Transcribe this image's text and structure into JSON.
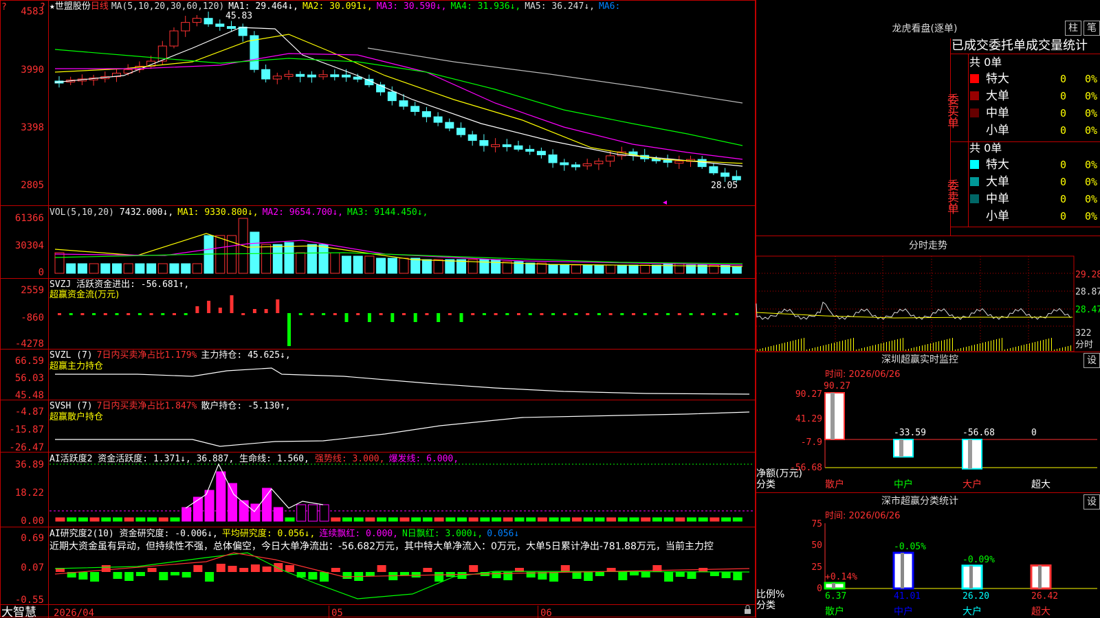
{
  "colors": {
    "up": "#ff3232",
    "down": "#54ffff",
    "ma1": "#ffffff",
    "ma2": "#ffff00",
    "ma3": "#ff00ff",
    "ma4": "#00ff00",
    "ma5": "#bbbbbb",
    "ma6": "#0080ff",
    "frame": "#c00000",
    "axis": "#ff3232"
  },
  "header": {
    "marker": "?",
    "star": "★",
    "stock": "世盟股份",
    "period": "日线",
    "ma_params": "MA(5,10,20,30,60,120)",
    "ma1": "MA1: 29.464↓,",
    "ma2": "MA2: 30.091↓,",
    "ma3": "MA3: 30.590↓,",
    "ma4": "MA4: 31.936↓,",
    "ma5": "MA5: 36.247↓,",
    "ma6": "MA6:"
  },
  "price": {
    "yaxis": [
      "4583",
      "3990",
      "3398",
      "2805"
    ],
    "high_label": "45.83",
    "low_label": "28.05"
  },
  "vol": {
    "legend": "VOL(5,10,20)",
    "value": "7432.000↓,",
    "ma1": "MA1: 9330.800↓,",
    "ma2": "MA2: 9654.700↓,",
    "ma3": "MA3: 9144.450↓,",
    "yaxis": [
      "61366",
      "30304",
      "0"
    ]
  },
  "svzj": {
    "legend": "SVZJ  活跃资金进出: -56.681↑,",
    "sub": "超赢资金流(万元)",
    "yaxis": [
      "2559",
      "-860",
      "-4278"
    ]
  },
  "svzl": {
    "legend": "SVZL (7)",
    "ratio": "7日内买卖净占比1.179%",
    "hold": "主力持仓: 45.625↓,",
    "sub": "超赢主力持仓",
    "yaxis": [
      "66.59",
      "56.03",
      "45.48"
    ]
  },
  "svsh": {
    "legend": "SVSH (7)",
    "ratio": "7日内买卖净占比1.847%",
    "hold": "散户持仓: -5.130↑,",
    "sub": "超赢散户持仓",
    "yaxis": [
      "-4.87",
      "-15.87",
      "-26.47"
    ]
  },
  "ai1": {
    "legend": "AI活跃度2 资金活跃度: 1.371↓, 36.887, 生命线: 1.560,",
    "strong": "强势线: 3.000,",
    "burst": "爆发线: 6.000,",
    "yaxis": [
      "36.89",
      "18.22",
      "0.00"
    ]
  },
  "ai2": {
    "legend": "AI研究度2(10) 资金研究度: -0.006↓,",
    "avg": "平均研究度: 0.056↓,",
    "red": "连续飘红: 0.000,",
    "nred": "N日飘红: 3.000↓,",
    "last": "0.056↓",
    "comment": "近期大资金虽有异动，但持续性不强，总体偏空，今日大单净流出：-56.682万元，其中特大单净流入：0万元，大单5日累计净出-781.88万元，当前主力控",
    "yaxis": [
      "0.69",
      "0.07",
      "-0.55"
    ]
  },
  "footer": {
    "brand": "大智慧",
    "dates": [
      "2026/04",
      "05",
      "06"
    ]
  },
  "lhb": {
    "title": "龙虎看盘(逐单)",
    "btn_zhu": "柱",
    "btn_bi": "笔",
    "subtitle": "已成交委托单成交量统计",
    "buy": {
      "side": "委买单",
      "total": "共 0单",
      "rows": [
        {
          "name": "特大",
          "val": "0",
          "pct": "0%",
          "color": "#ff0000"
        },
        {
          "name": "大单",
          "val": "0",
          "pct": "0%",
          "color": "#990000"
        },
        {
          "name": "中单",
          "val": "0",
          "pct": "0%",
          "color": "#660000"
        },
        {
          "name": "小单",
          "val": "0",
          "pct": "0%",
          "color": "#000000"
        }
      ]
    },
    "sell": {
      "side": "委卖单",
      "total": "共 0单",
      "rows": [
        {
          "name": "特大",
          "val": "0",
          "pct": "0%",
          "color": "#00ffff"
        },
        {
          "name": "大单",
          "val": "0",
          "pct": "0%",
          "color": "#009999"
        },
        {
          "name": "中单",
          "val": "0",
          "pct": "0%",
          "color": "#006666"
        },
        {
          "name": "小单",
          "val": "0",
          "pct": "0%",
          "color": "#000000"
        }
      ]
    }
  },
  "intraday": {
    "title": "分时走势",
    "yaxis": [
      "29.28",
      "28.87",
      "28.47",
      "322"
    ],
    "unit": "分时"
  },
  "monitor": {
    "title": "深圳超赢实时监控",
    "btn": "设",
    "time": "时间: 2026/06/26",
    "yaxis": [
      "90.27",
      "41.29",
      "-7.9",
      "-56.68"
    ],
    "ylabel1": "净额(万元)",
    "ylabel2": "分类",
    "cats": [
      "散户",
      "中户",
      "大户",
      "超大"
    ],
    "labels": [
      "90.27",
      "-33.59",
      "-56.68",
      "0"
    ],
    "chart_data": {
      "type": "bar",
      "categories": [
        "散户",
        "中户",
        "大户",
        "超大"
      ],
      "values": [
        90.27,
        -33.59,
        -56.68,
        0
      ],
      "ylabel": "净额(万元)",
      "ylim": [
        -56.68,
        90.27
      ]
    }
  },
  "classify": {
    "title": "深市超赢分类统计",
    "btn": "设",
    "time": "时间: 2026/06/26",
    "yaxis": [
      "75",
      "50",
      "25",
      "0"
    ],
    "ylabel1": "比例%",
    "ylabel2": "分类",
    "cats": [
      "散户",
      "中户",
      "大户",
      "超大"
    ],
    "values": [
      "6.37",
      "41.01",
      "26.20",
      "26.42"
    ],
    "changes": [
      "+0.14%",
      "-0.05%",
      "-0.09%",
      ""
    ],
    "chart_data": {
      "type": "bar",
      "categories": [
        "散户",
        "中户",
        "大户",
        "超大"
      ],
      "values": [
        6.37,
        41.01,
        26.2,
        26.42
      ],
      "ylabel": "比例%",
      "ylim": [
        0,
        75
      ]
    }
  }
}
